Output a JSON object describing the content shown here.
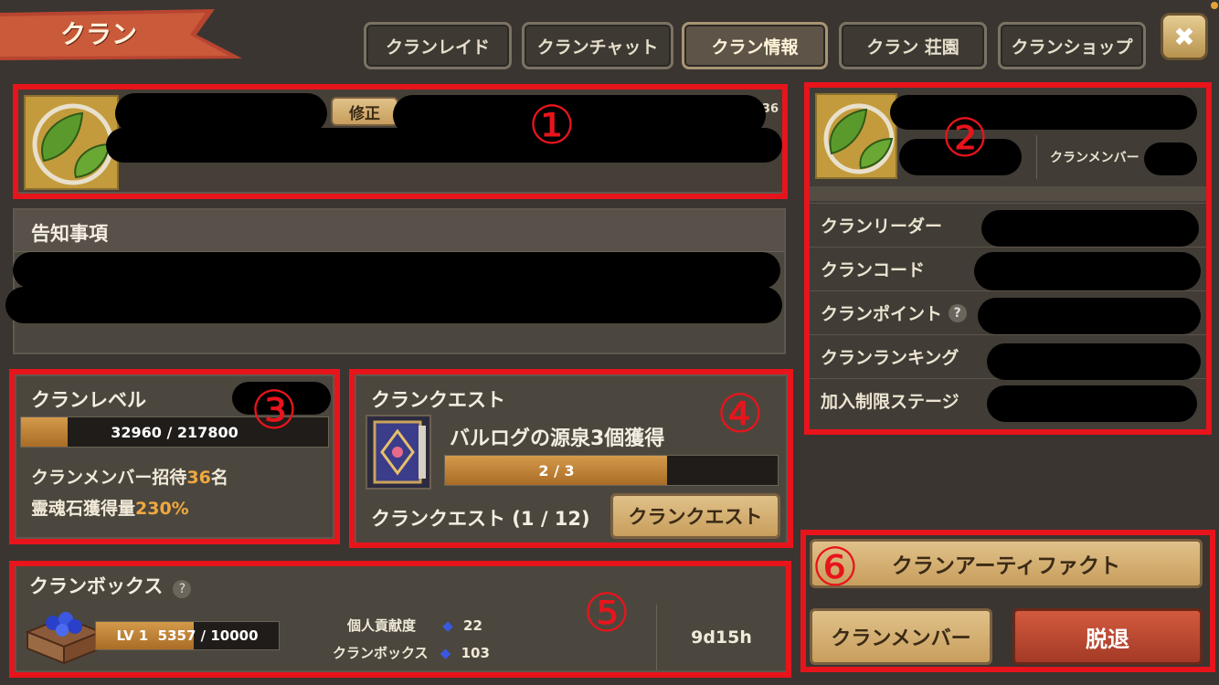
{
  "header": {
    "title": "クラン",
    "close_label": "✖"
  },
  "tabs": [
    "クランレイド",
    "クランチャット",
    "クラン情報",
    "クラン 荘園",
    "クランショップ"
  ],
  "profile": {
    "edit_label": "修正",
    "count_suffix": "/36"
  },
  "notice": {
    "title": "告知事項"
  },
  "side": {
    "member_label": "クランメンバー",
    "rows": [
      "クランリーダー",
      "クランコード",
      "クランポイント",
      "クランランキング",
      "加入制限ステージ"
    ]
  },
  "level": {
    "title": "クランレベル",
    "progress_text": "32960 / 217800",
    "progress_fraction": 0.151,
    "invite_prefix": "クランメンバー招待",
    "invite_num": "36",
    "invite_suffix": "名",
    "soul_prefix": "霊魂石獲得量",
    "soul_pct": "230%"
  },
  "quest": {
    "title": "クランクエスト",
    "task": "バルログの源泉3個獲得",
    "progress_text": "2 / 3",
    "progress_fraction": 0.667,
    "summary": "クランクエスト (1 / 12)",
    "button": "クランクエスト"
  },
  "box": {
    "title": "クランボックス",
    "help": "?",
    "level_label": "LV 1",
    "current": "5357",
    "max": "/ 10000",
    "progress_fraction": 0.536,
    "personal_label": "個人貢献度",
    "personal_val": "22",
    "box_label": "クランボックス",
    "box_val": "103",
    "timer": "9d15h"
  },
  "actions": {
    "artifact": "クランアーティファクト",
    "members": "クランメンバー",
    "leave": "脱退"
  },
  "markers": [
    "①",
    "②",
    "③",
    "④",
    "⑤",
    "⑥"
  ]
}
